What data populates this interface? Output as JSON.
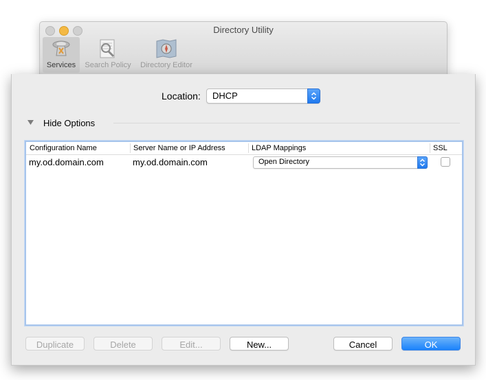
{
  "window": {
    "title": "Directory Utility",
    "toolbar": [
      {
        "label": "Services",
        "icon": "services-icon",
        "selected": true
      },
      {
        "label": "Search Policy",
        "icon": "search-policy-icon",
        "selected": false
      },
      {
        "label": "Directory Editor",
        "icon": "directory-editor-icon",
        "selected": false
      }
    ]
  },
  "sheet": {
    "location": {
      "label": "Location:",
      "value": "DHCP"
    },
    "options_toggle": {
      "label": "Hide Options",
      "expanded": true
    },
    "table": {
      "columns": [
        "Configuration Name",
        "Server Name or IP Address",
        "LDAP Mappings",
        "SSL"
      ],
      "rows": [
        {
          "configuration_name": "my.od.domain.com",
          "server": "my.od.domain.com",
          "ldap_mapping": "Open Directory",
          "ssl": false
        }
      ]
    },
    "buttons": {
      "duplicate": "Duplicate",
      "delete": "Delete",
      "edit": "Edit...",
      "new": "New...",
      "cancel": "Cancel",
      "ok": "OK"
    }
  },
  "colors": {
    "accent": "#1a82fb",
    "minimize": "#f4b944",
    "table_focus_ring": "#a7c5ec"
  }
}
